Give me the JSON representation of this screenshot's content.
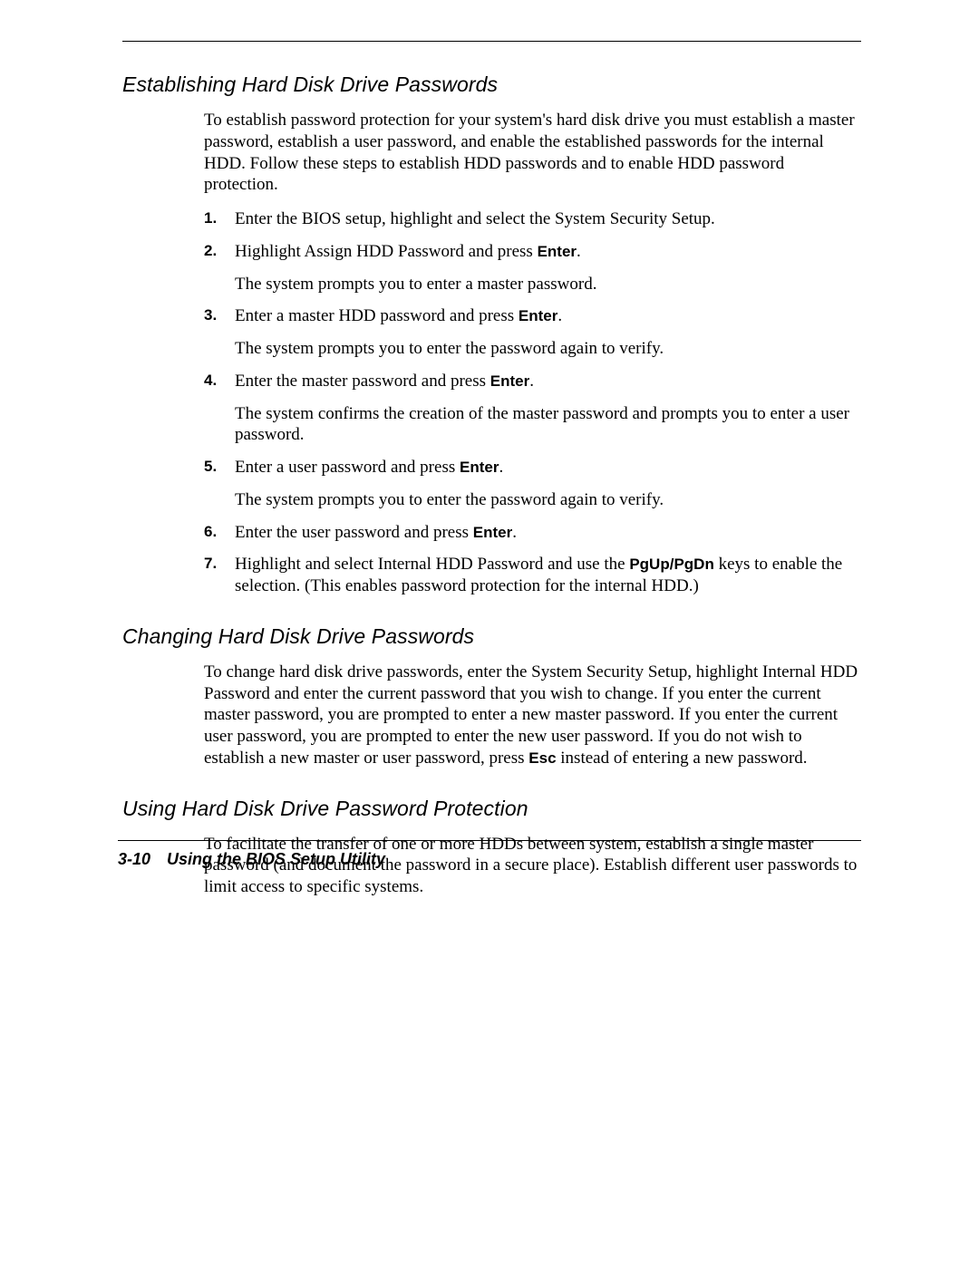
{
  "section1": {
    "heading": "Establishing Hard Disk Drive Passwords",
    "intro": "To establish password protection for your system's hard disk drive you must establish a master password, establish a user password, and enable the established passwords for the internal HDD. Follow these steps to establish HDD passwords and to enable HDD password protection.",
    "steps": [
      {
        "num": "1.",
        "lines": [
          {
            "segments": [
              {
                "t": "Enter the BIOS setup, highlight and select the System Security Setup."
              }
            ]
          }
        ]
      },
      {
        "num": "2.",
        "lines": [
          {
            "segments": [
              {
                "t": "Highlight Assign HDD Password and press "
              },
              {
                "t": "Enter",
                "b": true
              },
              {
                "t": "."
              }
            ]
          },
          {
            "segments": [
              {
                "t": "The system prompts you to enter a master password."
              }
            ]
          }
        ]
      },
      {
        "num": "3.",
        "lines": [
          {
            "segments": [
              {
                "t": "Enter a master HDD password and press "
              },
              {
                "t": "Enter",
                "b": true
              },
              {
                "t": "."
              }
            ]
          },
          {
            "segments": [
              {
                "t": "The system prompts you to enter the password again to verify."
              }
            ]
          }
        ]
      },
      {
        "num": "4.",
        "lines": [
          {
            "segments": [
              {
                "t": "Enter the master password and press "
              },
              {
                "t": "Enter",
                "b": true
              },
              {
                "t": "."
              }
            ]
          },
          {
            "segments": [
              {
                "t": "The system confirms the creation of the master password and prompts you to enter a user password."
              }
            ]
          }
        ]
      },
      {
        "num": "5.",
        "lines": [
          {
            "segments": [
              {
                "t": "Enter a user password and press "
              },
              {
                "t": "Enter",
                "b": true
              },
              {
                "t": "."
              }
            ]
          },
          {
            "segments": [
              {
                "t": "The system prompts you to enter the password again to verify."
              }
            ]
          }
        ]
      },
      {
        "num": "6.",
        "lines": [
          {
            "segments": [
              {
                "t": "Enter the user password and press "
              },
              {
                "t": "Enter",
                "b": true
              },
              {
                "t": "."
              }
            ]
          }
        ]
      },
      {
        "num": "7.",
        "lines": [
          {
            "segments": [
              {
                "t": "Highlight and select Internal HDD Password and use the "
              },
              {
                "t": "PgUp",
                "b": true
              },
              {
                "t": "/",
                "b": true
              },
              {
                "t": "PgDn",
                "b": true
              },
              {
                "t": " keys to enable the selection. (This enables password protection for the internal HDD.)"
              }
            ]
          }
        ]
      }
    ]
  },
  "section2": {
    "heading": "Changing Hard Disk Drive Passwords",
    "para_segments": [
      {
        "t": "To change hard disk drive passwords, enter the System Security Setup, highlight Internal HDD Password and enter the current password that you wish to change. If you enter the current master password, you are prompted to enter a new master password. If you enter the current user password, you are prompted to enter the new user password. If you do not wish to establish a new master or user password, press "
      },
      {
        "t": "Esc",
        "b": true
      },
      {
        "t": " instead of entering a new password."
      }
    ]
  },
  "section3": {
    "heading": "Using Hard Disk Drive Password Protection",
    "para": "To facilitate the transfer of one or more HDDs between system, establish a single master password (and document the password in a secure place). Establish different user passwords to limit access to specific systems."
  },
  "footer": {
    "pagenum": "3-10",
    "title": "Using the BIOS Setup Utility"
  }
}
